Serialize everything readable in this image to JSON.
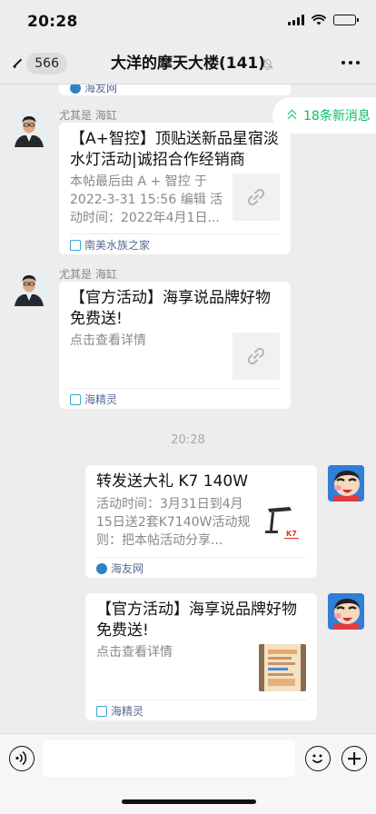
{
  "status_bar": {
    "time": "20:28",
    "battery_level": 0.25
  },
  "nav": {
    "back_count": "566",
    "title": "大洋的摩天大楼(141)",
    "mute_icon": "bell-slash-icon",
    "more_icon": "more-icon"
  },
  "new_messages": {
    "label": "18条新消息",
    "icon": "double-chevron-up-icon"
  },
  "messages": [
    {
      "type": "card-tail",
      "source": "海友网"
    },
    {
      "sender": "尤其是 海缸",
      "title": "【A+智控】顶贴送新品星宿淡水灯活动|诚招合作经销商",
      "desc": "本帖最后由 A + 智控 于 2022-3-31 15:56 编辑 活动时间：2022年4月1日...",
      "thumb_icon": "link-icon",
      "source": "南美水族之家"
    },
    {
      "sender": "尤其是 海缸",
      "title": "【官方活动】海享说品牌好物免费送!",
      "desc": "点击查看详情",
      "thumb_icon": "link-icon",
      "source": "海精灵"
    },
    {
      "type": "time",
      "text": "20:28"
    },
    {
      "self": true,
      "title": "转发送大礼 K7 140W",
      "desc": "活动时间：3月31日到4月15日送2套K7140W活动规则：把本帖活动分享...",
      "thumb_icon": "lamp-product-image",
      "source": "海友网"
    },
    {
      "self": true,
      "title": "【官方活动】海享说品牌好物免费送!",
      "desc": "点击查看详情",
      "thumb_icon": "promo-image",
      "source": "海精灵"
    }
  ],
  "input_bar": {
    "voice_icon": "voice-icon",
    "emoji_icon": "emoji-icon",
    "plus_icon": "plus-icon"
  },
  "colors": {
    "accent": "#07c160",
    "link": "#576b95",
    "bg": "#ededed"
  }
}
